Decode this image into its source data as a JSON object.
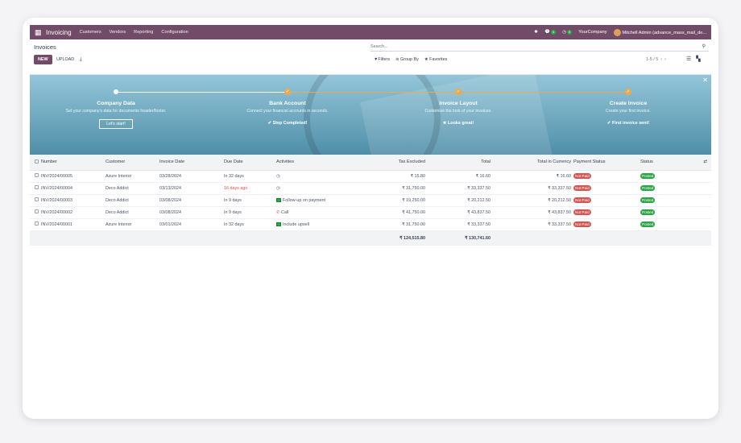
{
  "navbar": {
    "app_icon": "grid-icon",
    "app_name": "Invoicing",
    "menus": [
      "Customers",
      "Vendors",
      "Reporting",
      "Configuration"
    ],
    "messages_count": "5",
    "activities_count": "5",
    "company": "YourCompany",
    "user": "Mitchell Admin (advance_mass_mail_de..."
  },
  "control_panel": {
    "title": "Invoices",
    "new_label": "NEW",
    "upload_label": "UPLOAD",
    "search_placeholder": "Search...",
    "filters_label": "Filters",
    "groupby_label": "Group By",
    "favorites_label": "Favorites",
    "pager": "1-5 / 5"
  },
  "banner": {
    "steps": [
      {
        "title": "Company Data",
        "desc": "Set your company's data for documents header/footer.",
        "action": "Let's start!"
      },
      {
        "title": "Bank Account",
        "desc": "Connect your financial accounts in seconds.",
        "action": "Step Completed!"
      },
      {
        "title": "Invoice Layout",
        "desc": "Customize the look of your invoices.",
        "action": "Looks great!"
      },
      {
        "title": "Create Invoice",
        "desc": "Create your first invoice.",
        "action": "First invoice sent!"
      }
    ]
  },
  "table": {
    "headers": [
      "Number",
      "Customer",
      "Invoice Date",
      "Due Date",
      "Activities",
      "Tax Excluded",
      "Total",
      "Total in Currency",
      "Payment Status",
      "Status"
    ],
    "rows": [
      {
        "number": "INV/2024/00005",
        "customer": "Azure Interior",
        "invoice_date": "03/28/2024",
        "due_date": "In 32 days",
        "activity": "",
        "tax_excluded": "₹ 15.80",
        "total": "₹ 16.60",
        "total_currency": "₹ 16.60",
        "payment": "Not Paid",
        "status": "Posted"
      },
      {
        "number": "INV/2024/00004",
        "customer": "Deco Addict",
        "invoice_date": "03/13/2024",
        "due_date": "16 days ago",
        "activity": "",
        "tax_excluded": "₹ 31,750.00",
        "total": "₹ 33,337.50",
        "total_currency": "₹ 33,337.50",
        "payment": "Not Paid",
        "status": "Posted"
      },
      {
        "number": "INV/2024/00003",
        "customer": "Deco Addict",
        "invoice_date": "03/08/2024",
        "due_date": "In 9 days",
        "activity": "Follow-up on payment",
        "tax_excluded": "₹ 19,250.00",
        "total": "₹ 20,212.50",
        "total_currency": "₹ 20,212.50",
        "payment": "Not Paid",
        "status": "Posted"
      },
      {
        "number": "INV/2024/00002",
        "customer": "Deco Addict",
        "invoice_date": "03/08/2024",
        "due_date": "In 9 days",
        "activity": "Call",
        "tax_excluded": "₹ 41,750.00",
        "total": "₹ 43,837.50",
        "total_currency": "₹ 43,837.50",
        "payment": "Not Paid",
        "status": "Posted"
      },
      {
        "number": "INV/2024/00001",
        "customer": "Azure Interior",
        "invoice_date": "03/01/2024",
        "due_date": "In 32 days",
        "activity": "Include upsell",
        "tax_excluded": "₹ 31,750.00",
        "total": "₹ 33,337.50",
        "total_currency": "₹ 33,337.50",
        "payment": "Not Paid",
        "status": "Posted"
      }
    ],
    "totals": {
      "tax_excluded": "₹ 124,515.80",
      "total": "₹ 130,741.60"
    }
  },
  "colors": {
    "brand": "#714b67",
    "danger": "#d9534f",
    "success": "#28a745",
    "accent": "#f0a94a"
  }
}
